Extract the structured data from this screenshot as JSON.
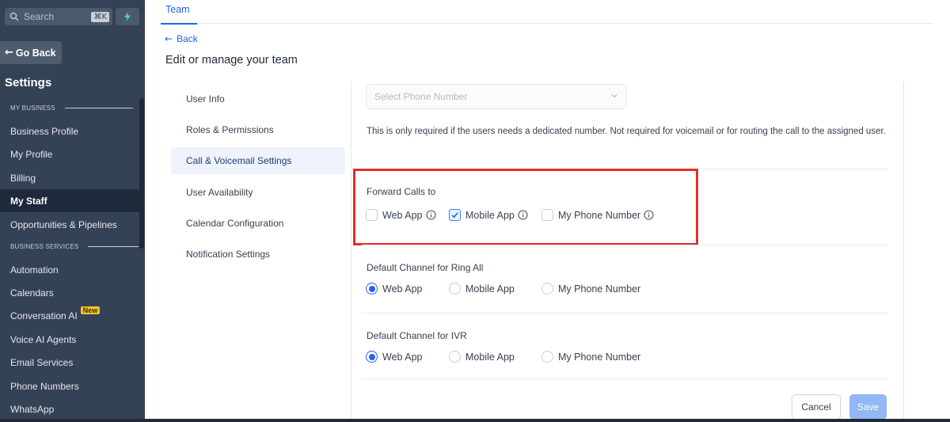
{
  "sidebar": {
    "search_placeholder": "Search",
    "search_shortcut": "⌘K",
    "go_back": "Go Back",
    "title": "Settings",
    "section_business": "MY BUSINESS",
    "section_services": "BUSINESS SERVICES",
    "items": [
      {
        "label": "Business Profile"
      },
      {
        "label": "My Profile"
      },
      {
        "label": "Billing"
      },
      {
        "label": "My Staff"
      },
      {
        "label": "Opportunities & Pipelines"
      },
      {
        "label": "Automation"
      },
      {
        "label": "Calendars"
      },
      {
        "label": "Conversation AI",
        "badge": "New"
      },
      {
        "label": "Voice AI Agents"
      },
      {
        "label": "Email Services"
      },
      {
        "label": "Phone Numbers"
      },
      {
        "label": "WhatsApp"
      }
    ],
    "active_item": "My Staff"
  },
  "header": {
    "tab": "Team",
    "back": "Back",
    "title": "Edit or manage your team"
  },
  "subnav": {
    "items": [
      {
        "label": "User Info"
      },
      {
        "label": "Roles & Permissions"
      },
      {
        "label": "Call & Voicemail Settings"
      },
      {
        "label": "User Availability"
      },
      {
        "label": "Calendar Configuration"
      },
      {
        "label": "Notification Settings"
      }
    ],
    "active_item": "Call & Voicemail Settings"
  },
  "form": {
    "phone_select_placeholder": "Select Phone Number",
    "help_text": "This is only required if the users needs a dedicated number. Not required for voicemail or for routing the call to the assigned user.",
    "forward_calls": {
      "label": "Forward Calls to",
      "options": [
        {
          "label": "Web App",
          "checked": false
        },
        {
          "label": "Mobile App",
          "checked": true
        },
        {
          "label": "My Phone Number",
          "checked": false
        }
      ]
    },
    "ring_all": {
      "label": "Default Channel for Ring All",
      "options": [
        {
          "label": "Web App",
          "selected": true
        },
        {
          "label": "Mobile App",
          "selected": false
        },
        {
          "label": "My Phone Number",
          "selected": false
        }
      ]
    },
    "ivr": {
      "label": "Default Channel for IVR",
      "options": [
        {
          "label": "Web App",
          "selected": true
        },
        {
          "label": "Mobile App",
          "selected": false
        },
        {
          "label": "My Phone Number",
          "selected": false
        }
      ]
    },
    "cancel": "Cancel",
    "save": "Save"
  },
  "colors": {
    "sidebar_bg": "#344256",
    "accent": "#2563eb",
    "highlight": "#e03128",
    "save_disabled": "#93b7f5"
  }
}
